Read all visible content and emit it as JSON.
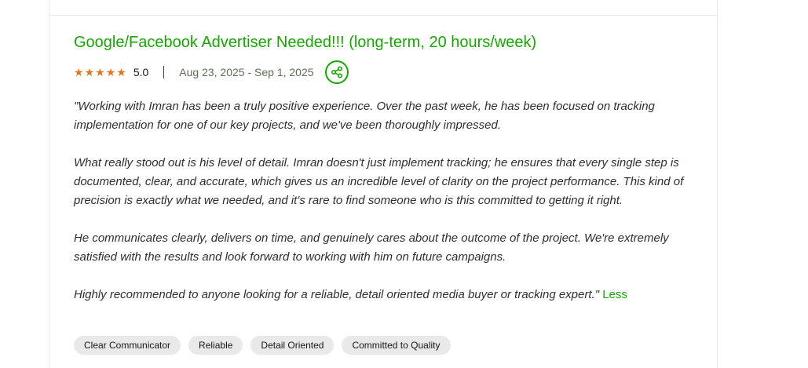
{
  "job": {
    "title": "Google/Facebook Advertiser Needed!!! (long-term, 20 hours/week)",
    "rating": "5.0",
    "stars": 5,
    "date_range": "Aug 23, 2025 - Sep 1, 2025",
    "share_icon": "share-icon"
  },
  "review": {
    "paragraphs": [
      "\"Working with Imran has been a truly positive experience. Over the past week, he has been focused on tracking implementation for one of our key projects, and we've been thoroughly impressed.",
      "What really stood out is his level of detail. Imran doesn't just implement tracking; he ensures that every single step is documented, clear, and accurate, which gives us an incredible level of clarity on the project performance. This kind of precision is exactly what we needed, and it's rare to find someone who is this committed to getting it right.",
      "He communicates clearly, delivers on time, and genuinely cares about the outcome of the project. We're extremely satisfied with the results and look forward to working with him on future campaigns.",
      "Highly recommended to anyone looking for a reliable, detail oriented media buyer or tracking expert.\""
    ],
    "less_label": "Less"
  },
  "tags": [
    "Clear Communicator",
    "Reliable",
    "Detail Oriented",
    "Committed to Quality"
  ],
  "colors": {
    "accent_green": "#14a800",
    "star_orange": "#e0761a",
    "tag_bg": "#e9e9e9"
  }
}
